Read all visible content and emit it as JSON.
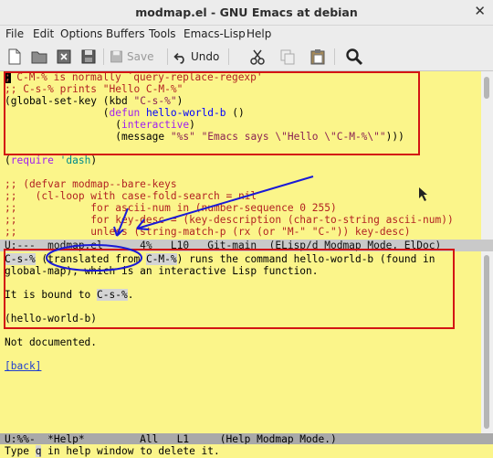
{
  "window": {
    "title": "modmap.el - GNU Emacs at debian",
    "close_glyph": "✕"
  },
  "menu": [
    "File",
    "Edit",
    "Options",
    "Buffers",
    "Tools",
    "Emacs-Lisp",
    "Help"
  ],
  "toolbar": {
    "save_label": "Save",
    "undo_label": "Undo",
    "icons": [
      "new-file-icon",
      "open-folder-icon",
      "close-buffer-icon",
      "save-icon",
      "undo-icon",
      "cut-icon",
      "copy-icon",
      "paste-icon",
      "search-icon"
    ]
  },
  "colors": {
    "buffer_bg": "#fbf58a",
    "comment": "#b22222",
    "string": "#8b2252",
    "function": "#0000ff",
    "keyword": "#a020f0",
    "annotation_red": "#d31414",
    "annotation_blue": "#1a1ad6"
  },
  "code": {
    "l1_comment": "; C-M-% is normally `query-replace-regexp'",
    "l2_comment": ";; C-s-% prints \"Hello C-M-%\"",
    "l3_a": "(global-set-key (kbd ",
    "l3_str": "\"C-s-%\"",
    "l3_b": ")",
    "l4_pre": "                (",
    "l4_kw": "defun",
    "l4_sp": " ",
    "l4_fn": "hello-world-b",
    "l4_post": " ()",
    "l5_pre": "                  (",
    "l5_kw": "interactive",
    "l5_post": ")",
    "l6_pre": "                  (message ",
    "l6_s1": "\"%s\"",
    "l6_sp": " ",
    "l6_s2": "\"Emacs says \\\"Hello \\\"C-M-%\\\"\"",
    "l6_post": ")))",
    "l8_a": "(",
    "l8_kw": "require",
    "l8_sp": " ",
    "l8_const": "'dash",
    "l8_b": ")",
    "l10": ";; (defvar modmap--bare-keys",
    "l11": ";;   (cl-loop with case-fold-search = nil",
    "l12": ";;            for ascii-num in (number-sequence 0 255)",
    "l13": ";;            for key-desc = (key-description (char-to-string ascii-num))",
    "l14": ";;            unless (string-match-p (rx (or \"M-\" \"C-\")) key-desc)"
  },
  "modeline_top": "U:---  modmap.el      4%   L10   Git-main  (ELisp/d Modmap Mode, ElDoc)",
  "help": {
    "key": "C-s-%",
    "t1": " (translated from ",
    "key2": "C-M-%",
    "t2": ") runs the command hello-world-b (found in",
    "line2": "global-map), which is an interactive Lisp function.",
    "bound_pre": "It is bound to ",
    "bound_key": "C-s-%",
    "bound_post": ".",
    "sig": "(hello-world-b)",
    "doc": "Not documented.",
    "back": "[back]"
  },
  "modeline_bottom": "U:%%-  *Help*         All   L1     (Help Modmap Mode.)",
  "echo": {
    "pre": "Type ",
    "key": "q",
    "post": " in help window to delete it."
  }
}
